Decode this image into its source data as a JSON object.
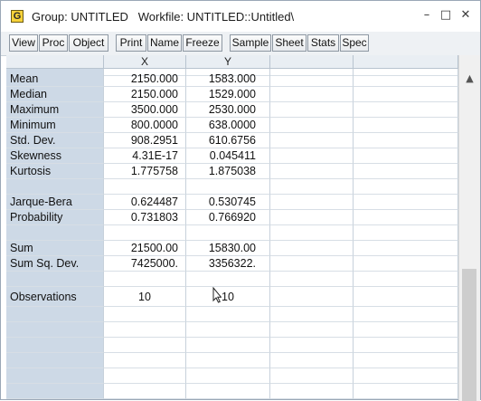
{
  "window": {
    "app_icon_letter": "G",
    "title": "Group: UNTITLED   Workfile: UNTITLED::Untitled\\",
    "minimize_glyph": "–",
    "maximize_glyph": "□",
    "close_glyph": "✕"
  },
  "toolbar": {
    "buttons": [
      "View",
      "Proc",
      "Object",
      "Print",
      "Name",
      "Freeze",
      "Sample",
      "Sheet",
      "Stats",
      "Spec"
    ]
  },
  "columns": {
    "x": "X",
    "y": "Y"
  },
  "stats": [
    {
      "label": "Mean",
      "x": "2150.000",
      "y": "1583.000"
    },
    {
      "label": "Median",
      "x": "2150.000",
      "y": "1529.000"
    },
    {
      "label": "Maximum",
      "x": "3500.000",
      "y": "2530.000"
    },
    {
      "label": "Minimum",
      "x": "800.0000",
      "y": "638.0000"
    },
    {
      "label": "Std. Dev.",
      "x": "908.2951",
      "y": "610.6756"
    },
    {
      "label": "Skewness",
      "x": "4.31E-17",
      "y": "0.045411"
    },
    {
      "label": "Kurtosis",
      "x": "1.775758",
      "y": "1.875038"
    },
    {
      "label": "",
      "x": "",
      "y": ""
    },
    {
      "label": "Jarque-Bera",
      "x": "0.624487",
      "y": "0.530745"
    },
    {
      "label": "Probability",
      "x": "0.731803",
      "y": "0.766920"
    },
    {
      "label": "",
      "x": "",
      "y": ""
    },
    {
      "label": "Sum",
      "x": "21500.00",
      "y": "15830.00"
    },
    {
      "label": "Sum Sq. Dev.",
      "x": "7425000.",
      "y": "3356322."
    },
    {
      "label": "",
      "x": "",
      "y": ""
    },
    {
      "label": "Observations",
      "x": "10",
      "y": "10"
    }
  ],
  "scrollbar": {
    "up_glyph": "▲"
  },
  "colors": {
    "label_column": "#cdd9e6",
    "header": "#e9eef3",
    "toolbar": "#eef1f4"
  }
}
